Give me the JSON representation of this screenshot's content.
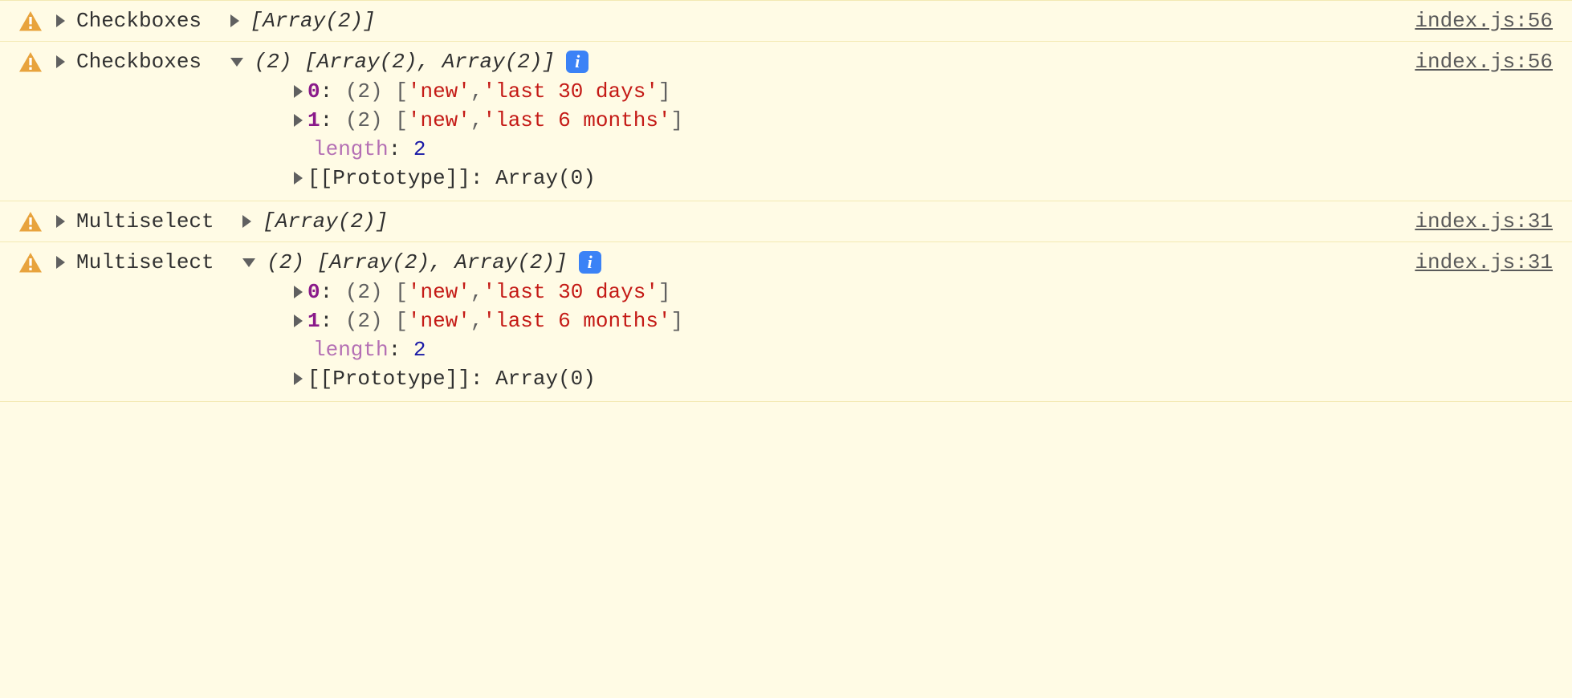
{
  "entries": [
    {
      "label": "Checkboxes",
      "summary_collapsed": "[Array(2)]",
      "source": "index.js:56",
      "expanded": false
    },
    {
      "label": "Checkboxes",
      "summary_expanded_prefix": "(2)",
      "summary_expanded_body": "[Array(2), Array(2)]",
      "source": "index.js:56",
      "expanded": true,
      "items": [
        {
          "index": "0",
          "count": "(2)",
          "open": "[",
          "v0": "'new'",
          "sep": ", ",
          "v1": "'last 30 days'",
          "close": "]"
        },
        {
          "index": "1",
          "count": "(2)",
          "open": "[",
          "v0": "'new'",
          "sep": ", ",
          "v1": "'last 6 months'",
          "close": "]"
        }
      ],
      "length_label": "length",
      "length_value": "2",
      "prototype_label": "[[Prototype]]",
      "prototype_value": "Array(0)"
    },
    {
      "label": "Multiselect",
      "summary_collapsed": "[Array(2)]",
      "source": "index.js:31",
      "expanded": false
    },
    {
      "label": "Multiselect",
      "summary_expanded_prefix": "(2)",
      "summary_expanded_body": "[Array(2), Array(2)]",
      "source": "index.js:31",
      "expanded": true,
      "items": [
        {
          "index": "0",
          "count": "(2)",
          "open": "[",
          "v0": "'new'",
          "sep": ", ",
          "v1": "'last 30 days'",
          "close": "]"
        },
        {
          "index": "1",
          "count": "(2)",
          "open": "[",
          "v0": "'new'",
          "sep": ", ",
          "v1": "'last 6 months'",
          "close": "]"
        }
      ],
      "length_label": "length",
      "length_value": "2",
      "prototype_label": "[[Prototype]]",
      "prototype_value": "Array(0)"
    }
  ],
  "info_glyph": "i"
}
